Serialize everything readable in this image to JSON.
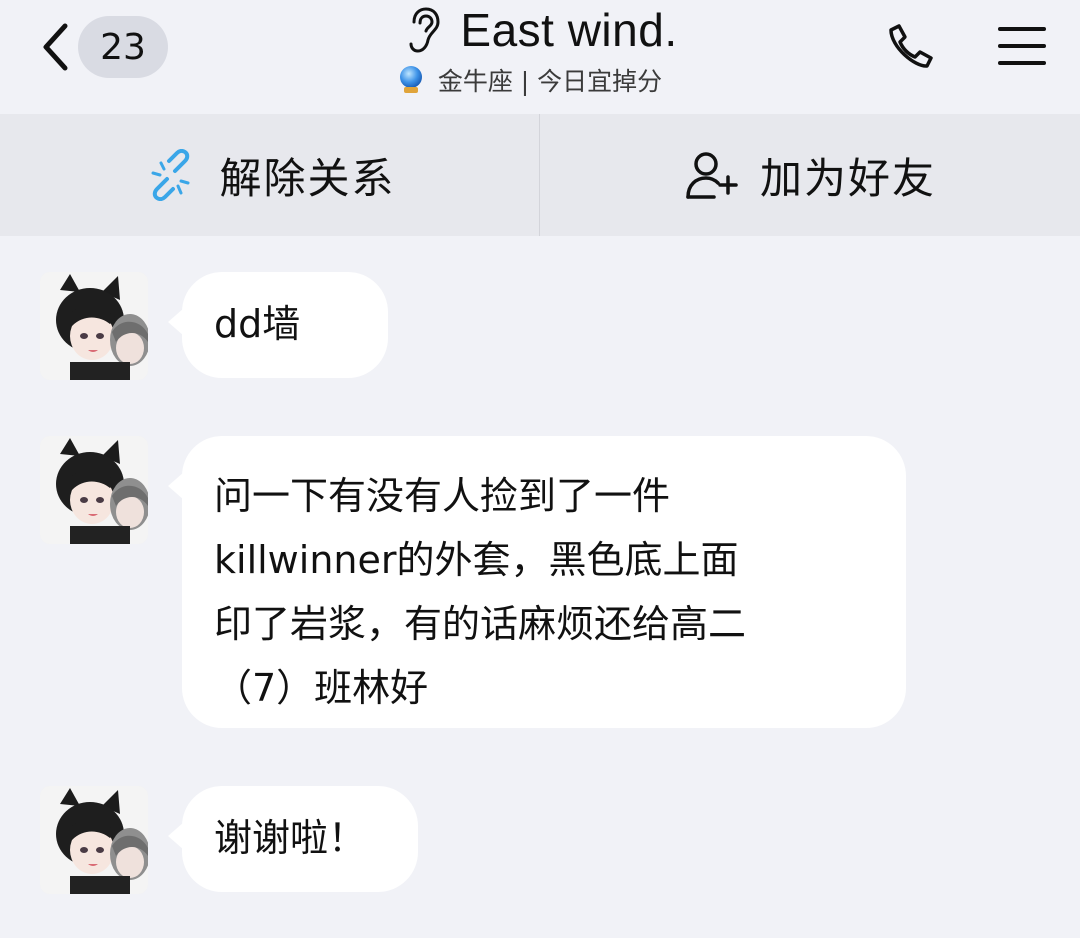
{
  "header": {
    "unread_count": "23",
    "title": "East wind.",
    "subtitle": "金牛座 | 今日宜掉分",
    "icons": {
      "back": "chevron-left-icon",
      "ear": "ear-icon",
      "crystal": "crystal-ball-icon",
      "phone": "phone-icon",
      "menu": "hamburger-menu-icon"
    }
  },
  "actions": {
    "unlink_label": "解除关系",
    "add_friend_label": "加为好友",
    "unlink_icon": "broken-link-icon",
    "add_friend_icon": "add-user-icon"
  },
  "messages": [
    {
      "lines": [
        "dd墙"
      ]
    },
    {
      "lines": [
        "问一下有没有人捡到了一件",
        "killwinner的外套，黑色底上面",
        "印了岩浆，有的话麻烦还给高二",
        "（7）班林好"
      ]
    },
    {
      "lines": [
        "谢谢啦！"
      ]
    }
  ],
  "colors": {
    "background": "#f1f2f7",
    "action_bar": "#e7e8ed",
    "badge": "#d9dbe3",
    "bubble": "#ffffff",
    "link_icon": "#3aa6e8"
  }
}
